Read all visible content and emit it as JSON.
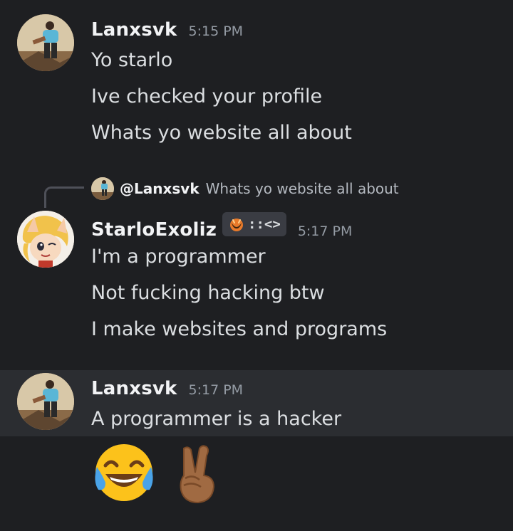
{
  "messages": [
    {
      "author": "Lanxsvk",
      "time": "5:15 PM",
      "lines": [
        "Yo starlo",
        "Ive checked your profile",
        "Whats yo website all about"
      ]
    },
    {
      "reply": {
        "author": "@Lanxsvk",
        "text": "Whats yo website all about"
      },
      "author": "StarloExoliz",
      "clan_tag": "::<>",
      "time": "5:17 PM",
      "lines": [
        "I'm a programmer",
        "Not fucking hacking btw",
        "I make websites and programs"
      ]
    },
    {
      "author": "Lanxsvk",
      "time": "5:17 PM",
      "lines": [
        "A programmer is a hacker"
      ],
      "emojis": [
        "joy-emoji",
        "victory-hand-emoji"
      ]
    }
  ],
  "colors": {
    "background": "#1e1f22",
    "hover_background": "#2b2d31",
    "username": "#f2f3f5",
    "timestamp": "#949ba4",
    "message_text": "#dbdee1"
  }
}
